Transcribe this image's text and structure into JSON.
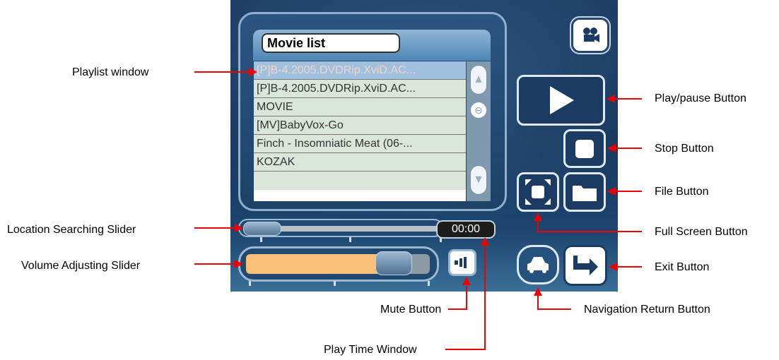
{
  "playlist": {
    "title": "Movie list",
    "items": [
      "[P]B-4.2005.DVDRip.XviD.AC...",
      "[P]B-4.2005.DVDRip.XviD.AC...",
      "MOVIE",
      "[MV]BabyVox-Go",
      "Finch - Insomniatic Meat (06-...",
      "KOZAK",
      ""
    ],
    "selected_index": 0
  },
  "player": {
    "play_time": "00:00",
    "seek_position": 0.0,
    "volume_level": 0.78
  },
  "icons": {
    "camera": "video-camera-icon",
    "play": "play-icon",
    "stop": "stop-icon",
    "fullscreen": "fullscreen-icon",
    "file": "folder-icon",
    "mute": "speaker-icon",
    "nav": "car-icon",
    "exit": "exit-arrow-icon"
  },
  "labels": {
    "playlist_window": "Playlist window",
    "location_slider": "Location Searching Slider",
    "volume_slider": "Volume Adjusting Slider",
    "mute_button": "Mute Button",
    "play_time_window": "Play Time Window",
    "play_pause_button": "Play/pause Button",
    "stop_button": "Stop Button",
    "file_button": "File Button",
    "full_screen_button": "Full Screen Button",
    "exit_button": "Exit Button",
    "navigation_return_button": "Navigation Return Button"
  },
  "colors": {
    "annotation_arrow": "#ee0000",
    "selected_row_text": "#f2d4c9",
    "volume_fill": "#f9bf78"
  }
}
